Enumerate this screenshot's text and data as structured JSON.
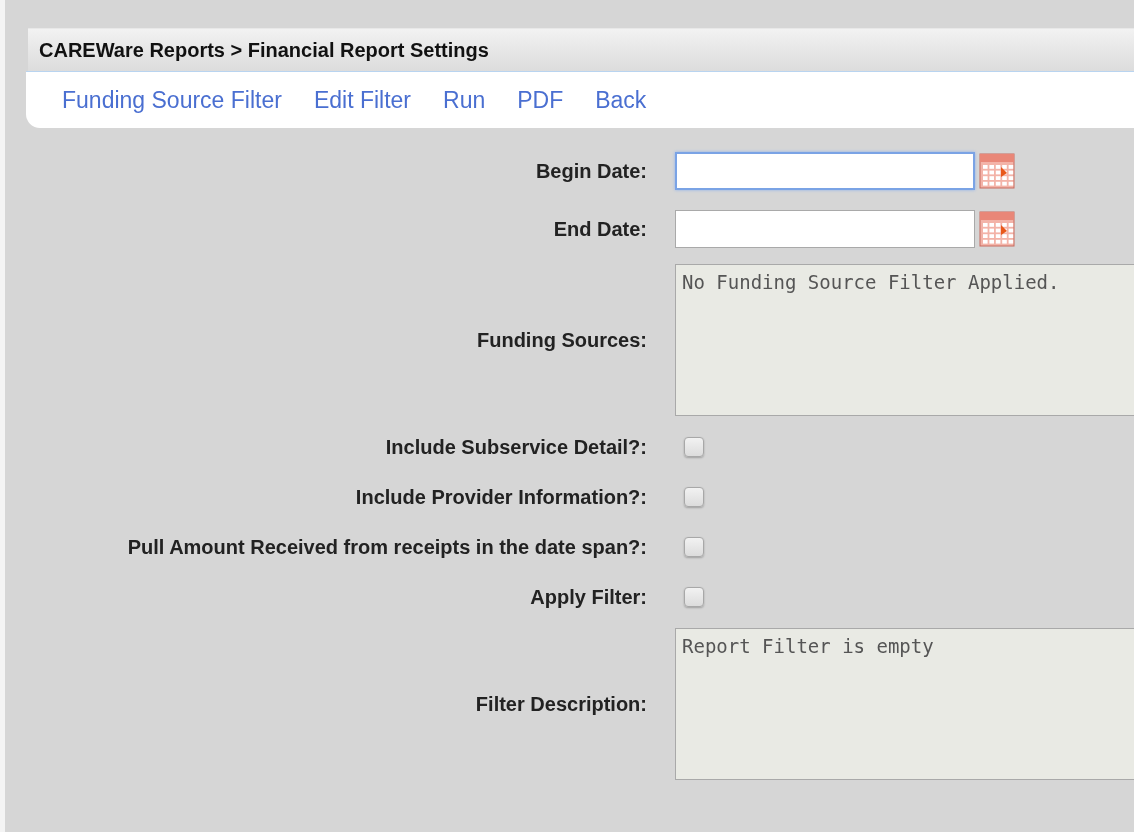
{
  "header": {
    "title": "CAREWare Reports > Financial Report Settings"
  },
  "nav": [
    {
      "label": "Funding Source Filter"
    },
    {
      "label": "Edit Filter"
    },
    {
      "label": "Run"
    },
    {
      "label": "PDF"
    },
    {
      "label": "Back"
    }
  ],
  "fields": [
    {
      "kind": "date",
      "label": "Begin Date:",
      "focused": true
    },
    {
      "kind": "date",
      "label": "End Date:",
      "focused": false
    },
    {
      "kind": "textarea",
      "label": "Funding Sources:",
      "value": "No Funding Source Filter Applied."
    },
    {
      "kind": "checkbox",
      "label": "Include Subservice Detail?:",
      "checked": false
    },
    {
      "kind": "checkbox",
      "label": "Include Provider Information?:",
      "checked": false
    },
    {
      "kind": "checkbox",
      "label": "Pull Amount Received from receipts in the date span?:",
      "checked": false
    },
    {
      "kind": "checkbox",
      "label": "Apply Filter:",
      "checked": false
    },
    {
      "kind": "textarea",
      "label": "Filter Description:",
      "value": "Report Filter is empty"
    }
  ]
}
